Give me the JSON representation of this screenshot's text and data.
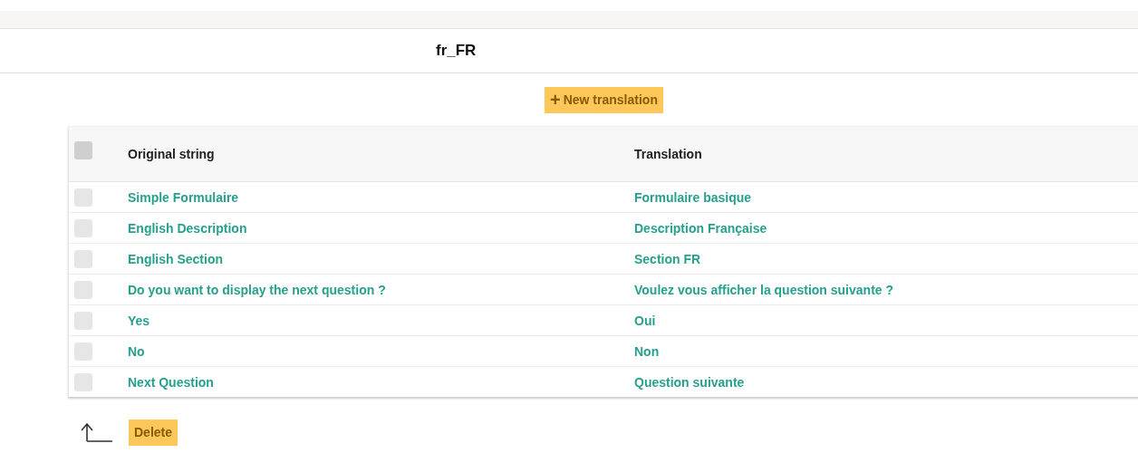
{
  "title": "fr_FR",
  "new_button": {
    "icon": "+",
    "label": "New translation"
  },
  "table": {
    "select_all": {
      "checked": false
    },
    "columns": [
      "Original string",
      "Translation"
    ],
    "rows": [
      {
        "original": "Simple Formulaire",
        "translation": "Formulaire basique",
        "checked": false
      },
      {
        "original": "English Description",
        "translation": "Description Française",
        "checked": false
      },
      {
        "original": "English Section",
        "translation": "Section FR",
        "checked": false
      },
      {
        "original": "Do you want to display the next question ?",
        "translation": "Voulez vous afficher la question suivante ?",
        "checked": false
      },
      {
        "original": "Yes",
        "translation": "Oui",
        "checked": false
      },
      {
        "original": "No",
        "translation": "Non",
        "checked": false
      },
      {
        "original": "Next Question",
        "translation": "Question suivante",
        "checked": false
      }
    ]
  },
  "delete_button": {
    "label": "Delete"
  }
}
